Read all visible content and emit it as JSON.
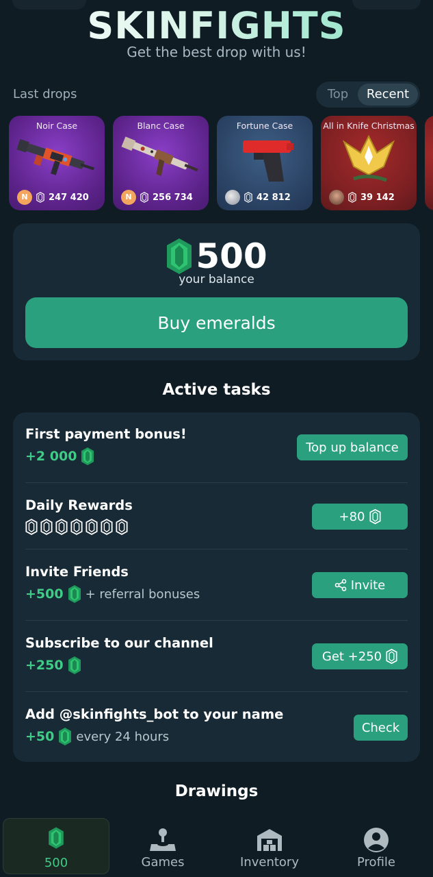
{
  "header": {
    "title": "SKINFIGHTS",
    "tagline": "Get the best drop with us!"
  },
  "last_drops": {
    "label": "Last drops",
    "toggle": {
      "options": [
        "Top",
        "Recent"
      ],
      "selected": "Recent"
    },
    "items": [
      {
        "case_name": "Noir Case",
        "user_initial": "N",
        "value": "247 420",
        "theme": "purple",
        "item_icon": "rifle-m4-icon"
      },
      {
        "case_name": "Blanc Case",
        "user_initial": "N",
        "value": "256 734",
        "theme": "purple",
        "item_icon": "rifle-ak-icon"
      },
      {
        "case_name": "Fortune Case",
        "user_initial": "",
        "value": "42 812",
        "theme": "blue",
        "item_icon": "pistol-icon"
      },
      {
        "case_name": "All in Knife Christmas",
        "user_initial": "",
        "value": "39 142",
        "theme": "red",
        "item_icon": "sticker-crown-icon"
      }
    ]
  },
  "balance": {
    "amount": "500",
    "label": "your balance",
    "buy_button": "Buy emeralds"
  },
  "tasks": {
    "title": "Active tasks",
    "items": [
      {
        "title": "First payment bonus!",
        "reward": "+2 000",
        "extra": "",
        "button": "Top up balance"
      },
      {
        "title": "Daily Rewards",
        "reward": "",
        "extra": "",
        "button": "+80",
        "daily_slots": 7
      },
      {
        "title": "Invite Friends",
        "reward": "+500",
        "extra": "+ referral bonuses",
        "button": "Invite"
      },
      {
        "title": "Subscribe to our channel",
        "reward": "+250",
        "extra": "",
        "button": "Get +250"
      },
      {
        "title": "Add @skinfights_bot to your name",
        "reward": "+50",
        "extra": "every 24 hours",
        "button": "Check"
      }
    ]
  },
  "drawings": {
    "title": "Drawings"
  },
  "nav": {
    "items": [
      {
        "label": "500",
        "icon": "emerald-icon",
        "active": true
      },
      {
        "label": "Games",
        "icon": "joystick-icon",
        "active": false
      },
      {
        "label": "Inventory",
        "icon": "warehouse-icon",
        "active": false
      },
      {
        "label": "Profile",
        "icon": "user-icon",
        "active": false
      }
    ]
  },
  "colors": {
    "background": "#0f1c24",
    "panel": "#172a35",
    "accent": "#2aa07f",
    "reward_green": "#3fcc87"
  }
}
